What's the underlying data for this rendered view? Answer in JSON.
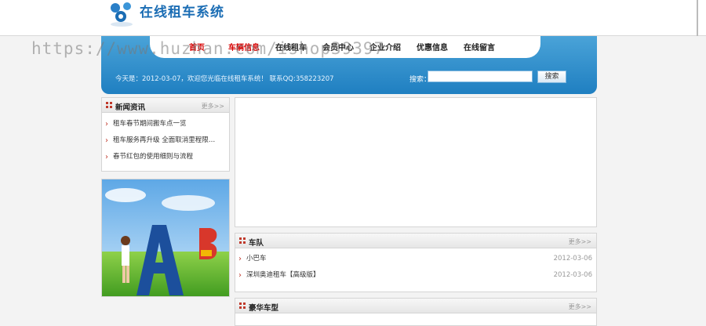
{
  "site": {
    "title": "在线租车系统"
  },
  "nav": {
    "items": [
      {
        "label": "首页",
        "state": "active"
      },
      {
        "label": "车辆信息",
        "state": "hot"
      },
      {
        "label": "在线租车",
        "state": ""
      },
      {
        "label": "会员中心",
        "state": ""
      },
      {
        "label": "企业介绍",
        "state": ""
      },
      {
        "label": "优惠信息",
        "state": ""
      },
      {
        "label": "在线留言",
        "state": ""
      }
    ]
  },
  "header": {
    "welcome": "今天是：2012-03-07，欢迎您光临在线租车系统！ 联系QQ:358223207",
    "search_label": "搜索：",
    "search_value": "",
    "search_button": "搜索"
  },
  "watermark": "https://www.huzhan.com/ishop39397",
  "news": {
    "title": "新闻资讯",
    "more": "更多>>",
    "items": [
      "租车春节期间搬车点一览",
      "租车服务再升级 全面取消里程限…",
      "春节红包的使用细则与流程"
    ]
  },
  "fleet": {
    "title": "车队",
    "more": "更多>>",
    "items": [
      {
        "name": "小巴车",
        "date": "2012-03-06"
      },
      {
        "name": "深圳奥迪租车【高级版】",
        "date": "2012-03-06"
      }
    ]
  },
  "luxury": {
    "title": "豪华车型",
    "more": "更多>>"
  },
  "colors": {
    "brand": "#1b6db4",
    "nav_bar": "#1f7fc1",
    "accent_red": "#d60000"
  }
}
